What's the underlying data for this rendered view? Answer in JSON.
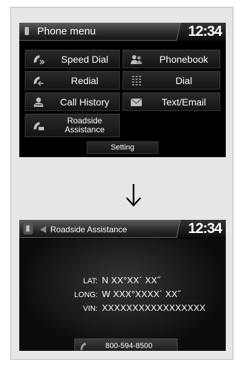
{
  "screen1": {
    "title": "Phone menu",
    "clock": "12:34",
    "menu": {
      "speed_dial": "Speed Dial",
      "phonebook": "Phonebook",
      "redial": "Redial",
      "dial": "Dial",
      "call_history": "Call History",
      "text_email": "Text/Email",
      "roadside_line1": "Roadside",
      "roadside_line2": "Assistance",
      "setting": "Setting"
    }
  },
  "screen2": {
    "title": "Roadside Assistance",
    "clock": "12:34",
    "lat_label": "LAT:",
    "lat_value": "N XX°XX´ XX˝",
    "long_label": "LONG:",
    "long_value": "W XXX°XXXX´ XX˝",
    "vin_label": "VIN:",
    "vin_value": "XXXXXXXXXXXXXXXXX",
    "call_number": "800-594-8500"
  },
  "icons": [
    "phone-icon",
    "speed-dial-icon",
    "phonebook-icon",
    "redial-icon",
    "dial-keypad-icon",
    "call-history-icon",
    "envelope-icon",
    "roadside-icon",
    "down-arrow-icon",
    "back-arrow-icon",
    "handset-icon"
  ],
  "colors": {
    "screen_bg": "#000000",
    "text": "#ffffff",
    "panel_bg": "#e6e6e6"
  }
}
